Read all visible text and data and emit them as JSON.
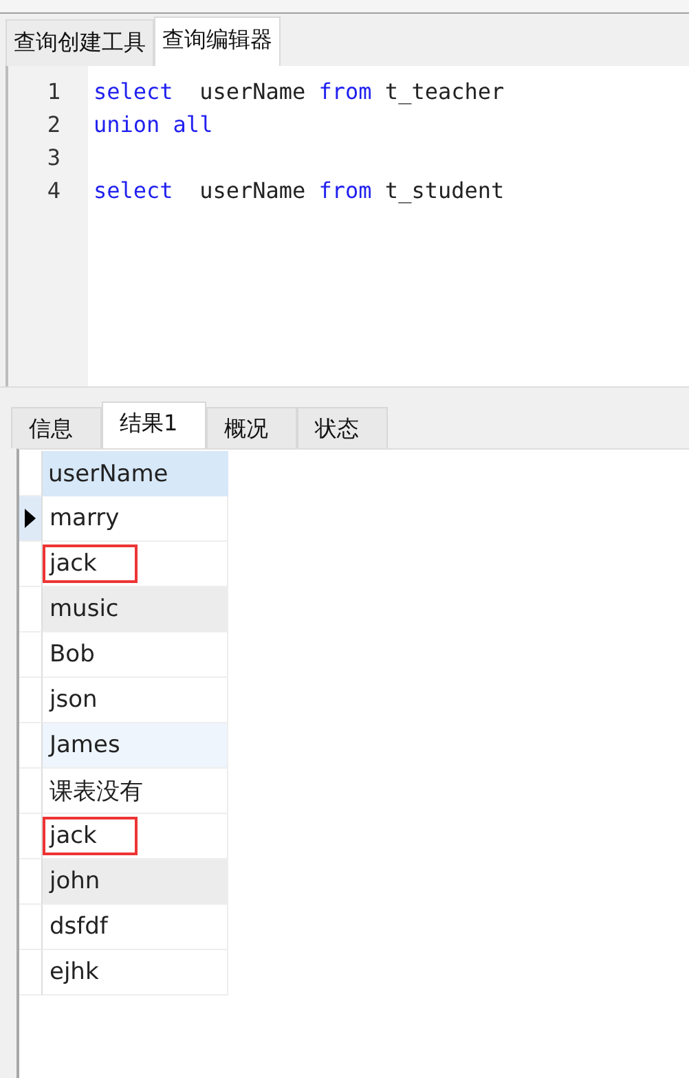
{
  "editor_tabs": [
    {
      "label": "查询创建工具",
      "selected": false
    },
    {
      "label": "查询编辑器",
      "selected": true
    }
  ],
  "code_lines": [
    {
      "number": "1",
      "tokens": [
        {
          "text": "select",
          "kind": "keyword"
        },
        {
          "text": "  userName ",
          "kind": "plain"
        },
        {
          "text": "from",
          "kind": "keyword"
        },
        {
          "text": " t_teacher",
          "kind": "plain"
        }
      ]
    },
    {
      "number": "2",
      "tokens": [
        {
          "text": "union all",
          "kind": "keyword"
        }
      ]
    },
    {
      "number": "3"
    },
    {
      "number": "4",
      "tokens": [
        {
          "text": "select",
          "kind": "keyword"
        },
        {
          "text": "  userName ",
          "kind": "plain"
        },
        {
          "text": "from",
          "kind": "keyword"
        },
        {
          "text": " t_student",
          "kind": "plain"
        }
      ]
    }
  ],
  "result_tabs": [
    {
      "label": "信息",
      "selected": false
    },
    {
      "label": "结果1",
      "selected": true
    },
    {
      "label": "概况",
      "selected": false
    },
    {
      "label": "状态",
      "selected": false
    }
  ],
  "table": {
    "columns": [
      "userName"
    ],
    "rows": [
      {
        "value": "marry",
        "selected": true,
        "kind": "plain",
        "outlined": false
      },
      {
        "value": "jack",
        "selected": false,
        "kind": "plain",
        "outlined": true
      },
      {
        "value": "music",
        "selected": false,
        "kind": "grey",
        "outlined": false
      },
      {
        "value": "Bob",
        "selected": false,
        "kind": "plain",
        "outlined": false
      },
      {
        "value": "json",
        "selected": false,
        "kind": "plain",
        "outlined": false
      },
      {
        "value": "James",
        "selected": false,
        "kind": "blue",
        "outlined": false
      },
      {
        "value": "课表没有",
        "selected": false,
        "kind": "plain",
        "outlined": false
      },
      {
        "value": "jack",
        "selected": false,
        "kind": "plain",
        "outlined": true
      },
      {
        "value": "john",
        "selected": false,
        "kind": "grey",
        "outlined": false
      },
      {
        "value": "dsfdf",
        "selected": false,
        "kind": "plain",
        "outlined": false
      },
      {
        "value": "ejhk",
        "selected": false,
        "kind": "plain",
        "outlined": false
      }
    ]
  }
}
